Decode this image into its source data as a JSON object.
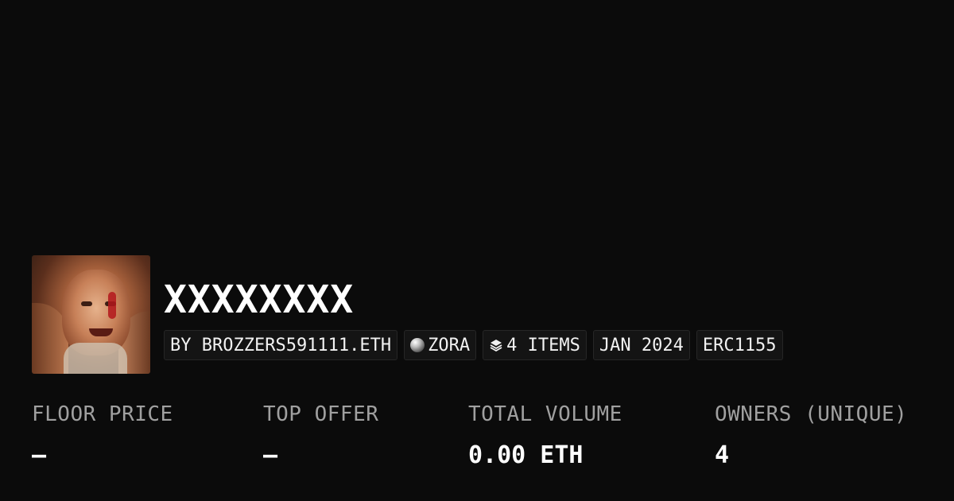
{
  "collection": {
    "title": "XXXXXXXX",
    "avatar_icon": "collection-avatar",
    "tags": {
      "creator": "BY BROZZERS591111.ETH",
      "network": "ZORA",
      "network_icon": "zora-orb-icon",
      "items": "4 ITEMS",
      "items_icon": "layers-icon",
      "date": "JAN 2024",
      "standard": "ERC1155"
    }
  },
  "stats": {
    "floor_price": {
      "label": "FLOOR PRICE",
      "value": "–"
    },
    "top_offer": {
      "label": "TOP OFFER",
      "value": "–"
    },
    "total_volume": {
      "label": "TOTAL VOLUME",
      "value": "0.00 ETH"
    },
    "owners": {
      "label": "OWNERS (UNIQUE)",
      "value": "4"
    }
  },
  "colors": {
    "background": "#0b0b0b",
    "text": "#ffffff",
    "muted": "#a0a0a0",
    "tag_bg": "#141414",
    "tag_border": "#262626"
  }
}
